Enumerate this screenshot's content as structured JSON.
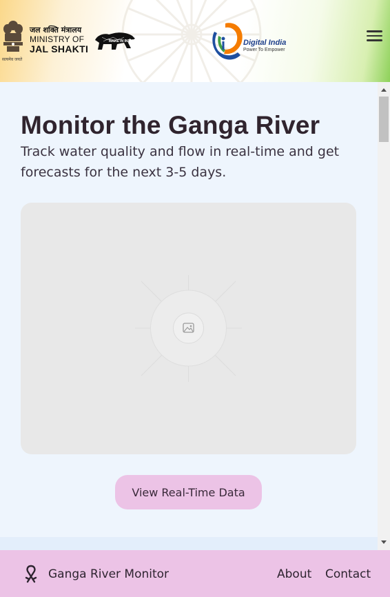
{
  "header": {
    "emblem_caption": "सत्यमेव जयते",
    "ministry_hindi": "जल शक्ति मंत्रालय",
    "ministry_line1": "MINISTRY OF",
    "ministry_line2": "JAL SHAKTI",
    "make_in_india": "MAKE IN INDIA",
    "digital_india_title": "Digital India",
    "digital_india_tagline": "Power To Empower",
    "menu_icon": "hamburger-menu-icon"
  },
  "hero": {
    "title": "Monitor the Ganga River",
    "subtitle": "Track water quality and flow in real-time and get forecasts for the next 3-5 days.",
    "image_icon": "image-placeholder-icon",
    "cta_label": "View Real-Time Data"
  },
  "footer": {
    "brand": "Ganga River Monitor",
    "logo_icon": "ribbon-logo-icon",
    "links": [
      {
        "label": "About"
      },
      {
        "label": "Contact"
      }
    ]
  },
  "colors": {
    "main_bg": "#eef5fd",
    "accent": "#ecc3e6",
    "title_text": "#30242e",
    "placeholder_bg": "#e8e8e8"
  }
}
